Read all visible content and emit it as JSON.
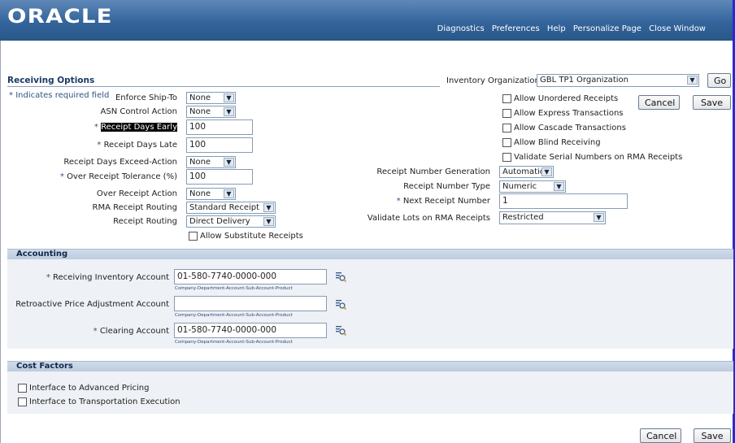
{
  "header": {
    "logo": "ORACLE",
    "nav": [
      "Diagnostics",
      "Preferences",
      "Help",
      "Personalize Page",
      "Close Window"
    ]
  },
  "page": {
    "title": "Receiving Options",
    "required_note": "Indicates required field",
    "inventory_org_label": "Inventory Organization",
    "inventory_org_value": "GBL TP1 Organization",
    "go_label": "Go",
    "cancel_label": "Cancel",
    "save_label": "Save"
  },
  "left_fields": {
    "enforce_ship_to": {
      "label": "Enforce Ship-To",
      "value": "None"
    },
    "asn_control": {
      "label": "ASN Control Action",
      "value": "None"
    },
    "days_early": {
      "label": "Receipt Days Early",
      "value": "100"
    },
    "days_late": {
      "label": "Receipt Days Late",
      "value": "100"
    },
    "days_exceed": {
      "label": "Receipt Days Exceed-Action",
      "value": "None"
    },
    "over_tolerance": {
      "label": "Over Receipt Tolerance (%)",
      "value": "100"
    },
    "over_action": {
      "label": "Over Receipt Action",
      "value": "None"
    },
    "rma_routing": {
      "label": "RMA Receipt Routing",
      "value": "Standard Receipt"
    },
    "receipt_routing": {
      "label": "Receipt Routing",
      "value": "Direct Delivery"
    },
    "allow_substitute": "Allow Substitute Receipts"
  },
  "right_checks": [
    "Allow Unordered Receipts",
    "Allow Express Transactions",
    "Allow Cascade Transactions",
    "Allow Blind Receiving",
    "Validate Serial Numbers on RMA Receipts"
  ],
  "right_fields": {
    "number_generation": {
      "label": "Receipt Number Generation",
      "value": "Automatic"
    },
    "number_type": {
      "label": "Receipt Number Type",
      "value": "Numeric"
    },
    "next_number": {
      "label": "Next Receipt Number",
      "value": "1"
    },
    "validate_lots": {
      "label": "Validate Lots on RMA Receipts",
      "value": "Restricted"
    }
  },
  "accounting": {
    "title": "Accounting",
    "hint": "Company-Department-Account-Sub-Account-Product",
    "receiving_inventory": {
      "label": "Receiving Inventory Account",
      "value": "01-580-7740-0000-000"
    },
    "retroactive": {
      "label": "Retroactive Price Adjustment Account",
      "value": ""
    },
    "clearing": {
      "label": "Clearing Account",
      "value": "01-580-7740-0000-000"
    }
  },
  "cost_factors": {
    "title": "Cost Factors",
    "items": [
      "Interface to Advanced Pricing",
      "Interface to Transportation Execution"
    ]
  },
  "colors": {
    "brand_blue": "#33649b",
    "section_header": "#c6d3e6",
    "required": "#2f5580"
  }
}
